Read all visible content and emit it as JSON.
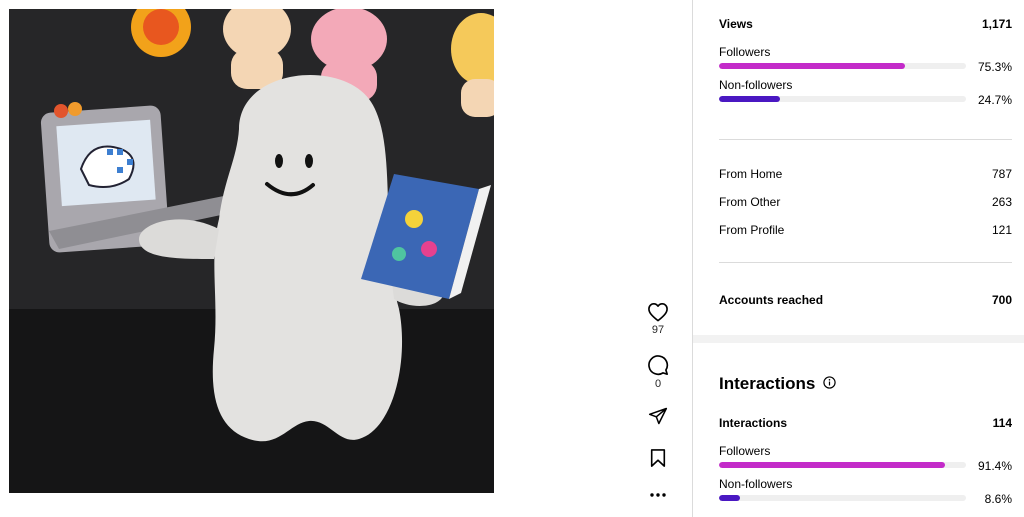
{
  "actions": {
    "likes": "97",
    "comments": "0"
  },
  "views": {
    "label": "Views",
    "value": "1,171",
    "followers": {
      "label": "Followers",
      "pct_text": "75.3%",
      "fraction": 0.753
    },
    "non_followers": {
      "label": "Non-followers",
      "pct_text": "24.7%",
      "fraction": 0.247
    }
  },
  "sources": [
    {
      "label": "From Home",
      "value": "787"
    },
    {
      "label": "From Other",
      "value": "263"
    },
    {
      "label": "From Profile",
      "value": "121"
    }
  ],
  "reach": {
    "label": "Accounts reached",
    "value": "700"
  },
  "interactions": {
    "section_title": "Interactions",
    "label": "Interactions",
    "value": "114",
    "followers": {
      "label": "Followers",
      "pct_text": "91.4%",
      "fraction": 0.914
    },
    "non_followers": {
      "label": "Non-followers",
      "pct_text": "8.6%",
      "fraction": 0.086
    }
  },
  "colors": {
    "followers_bar": "#c32bc9",
    "non_followers_bar": "#4a18c2",
    "track": "#efefef",
    "divider": "#dbdbdb"
  },
  "icons": [
    "heart-icon",
    "comment-icon",
    "share-icon",
    "bookmark-icon",
    "more-icon",
    "info-icon"
  ]
}
